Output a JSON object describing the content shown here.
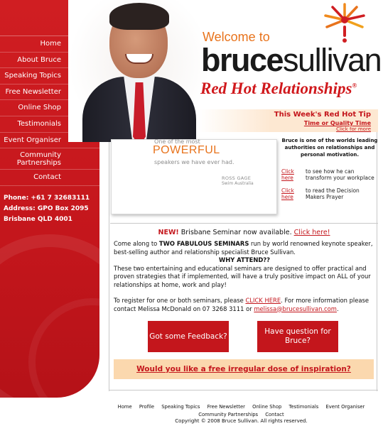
{
  "nav": {
    "items": [
      {
        "label": "Home"
      },
      {
        "label": "About Bruce"
      },
      {
        "label": "Speaking Topics"
      },
      {
        "label": "Free Newsletter"
      },
      {
        "label": "Online Shop"
      },
      {
        "label": "Testimonials"
      },
      {
        "label": "Event Organiser"
      },
      {
        "label": "Community Partnerships"
      },
      {
        "label": "Contact"
      }
    ]
  },
  "contact": {
    "phone": "Phone: +61 7 32683111",
    "address1": "Address: GPO Box 2095",
    "address2": "Brisbane QLD 4001"
  },
  "header": {
    "welcome": "Welcome to",
    "brand_bold": "bruce",
    "brand_light": "sullivan",
    "tagline": "Red Hot Relationships",
    "trademark": "®"
  },
  "tip": {
    "title": "This Week's Red Hot Tip",
    "topic": "Time or Quality Time",
    "more": "Click for more"
  },
  "quote": {
    "pre": "One of the most",
    "emphasis": "POWERFUL",
    "post": "speakers we have ever had.",
    "author": "ROSS GAGE",
    "org": "Swim Australia"
  },
  "authority": "Bruce is one of the worlds leading authorities on relationships and personal motivation.",
  "clicks": [
    {
      "link": "Click here",
      "text": "to see how he can transform your workplace"
    },
    {
      "link": "Click here",
      "text": "to read the Decision Makers Prayer"
    }
  ],
  "seminar": {
    "new_label": "NEW!",
    "headline": " Brisbane Seminar now available. ",
    "headline_link": "Click here!",
    "intro_pre": "Come along to ",
    "intro_bold": "TWO FABULOUS SEMINARS",
    "intro_post": " run by world renowned keynote speaker, best-selling author and relationship specialist Bruce Sullivan.",
    "why": "WHY ATTEND??",
    "body": "These two entertaining and educational seminars are designed to offer practical and proven strategies that if implemented, will have a truly positive impact on ALL of your relationships at home, work and play!",
    "register_pre": "To register for one or both seminars, please ",
    "register_link": "CLICK HERE",
    "register_mid": ". For more information please contact Melissa McDonald on 07 3268 3111 or ",
    "email": "melissa@brucesullivan.com",
    "register_end": "."
  },
  "buttons": {
    "feedback": "Got some Feedback?",
    "question": "Have question for Bruce?"
  },
  "inspiration": "Would you like a free irregular dose of inspiration?",
  "footer": {
    "links": [
      "Home",
      "Profile",
      "Speaking Topics",
      "Free Newsletter",
      "Online Shop",
      "Testimonials",
      "Event Organiser",
      "Community Partnerships",
      "Contact"
    ],
    "copyright": "Copyright © 2008 Bruce Sullivan. All rights reserved."
  },
  "colors": {
    "brand_red": "#c4161c",
    "accent_orange": "#e8731c",
    "tip_bg": "#fde8d2",
    "inspire_bg": "#fbd8ae"
  }
}
